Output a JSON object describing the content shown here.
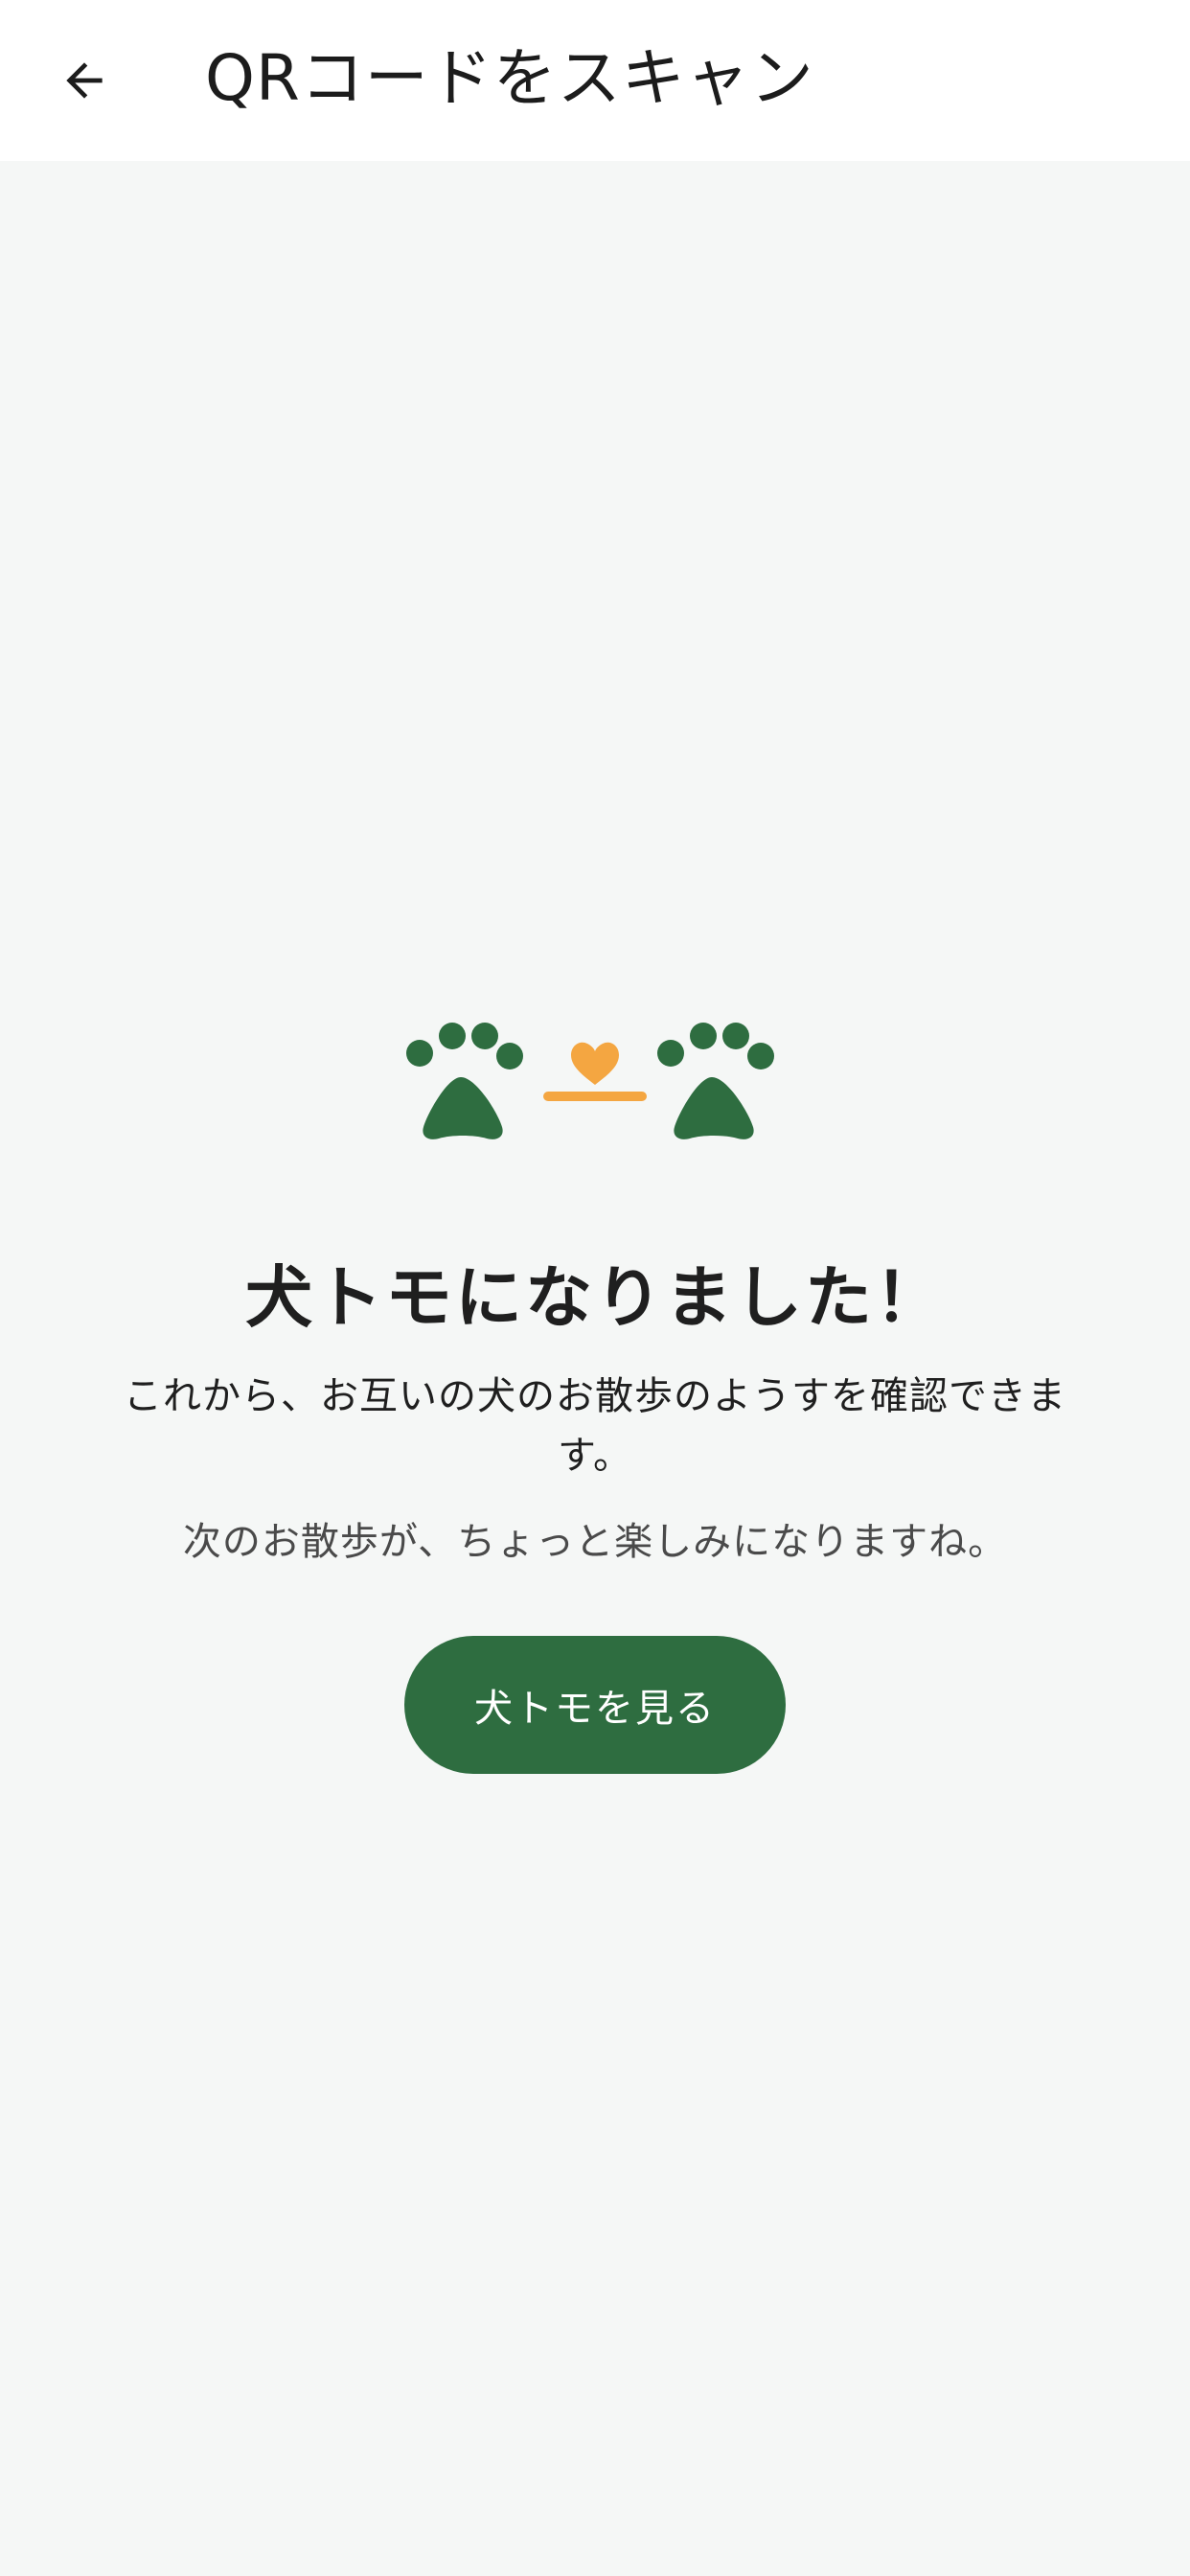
{
  "app_bar": {
    "title": "QRコードをスキャン",
    "back_icon": "arrow-left-icon"
  },
  "illustration": {
    "left_icon": "paw-icon",
    "middle_icon": "heart-icon",
    "right_icon": "paw-icon",
    "paw_color": "#2e6d40",
    "heart_color": "#f4a641"
  },
  "success": {
    "heading": "犬トモになりました！",
    "description": "これから、お互いの犬のお散歩のようすを確認できます。",
    "subtext": "次のお散歩が、ちょっと楽しみになりますね。"
  },
  "actions": {
    "view_friends_label": "犬トモを見る"
  },
  "colors": {
    "background": "#f5f7f6",
    "app_bar": "#ffffff",
    "primary": "#2e6d40",
    "accent": "#f4a641"
  }
}
